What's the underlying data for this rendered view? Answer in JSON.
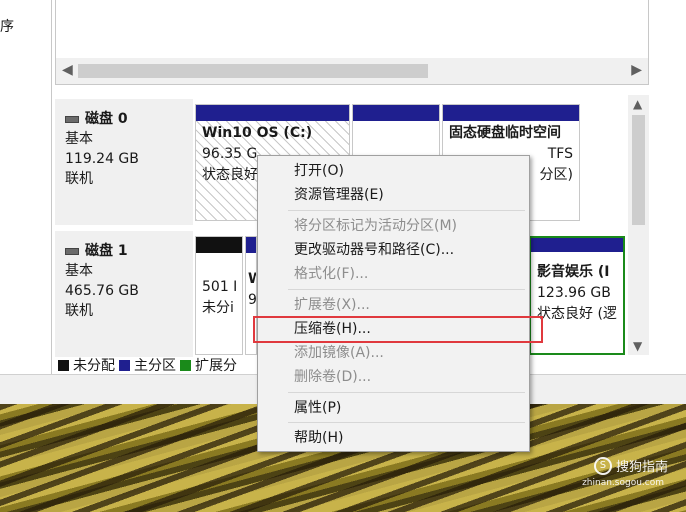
{
  "left_pane": {
    "label": "序"
  },
  "disks": [
    {
      "name": "磁盘 0",
      "type": "基本",
      "size": "119.24 GB",
      "status": "联机",
      "partitions": [
        {
          "title": "Win10 OS  (C:)",
          "line2": "96.35 G",
          "line3": "状态良好"
        },
        {
          "title": "",
          "line2": "",
          "line3": ""
        },
        {
          "title": "固态硬盘临时空间",
          "line2": "TFS",
          "line3": "分区)"
        }
      ]
    },
    {
      "name": "磁盘 1",
      "type": "基本",
      "size": "465.76 GB",
      "status": "联机",
      "partitions": [
        {
          "title": "",
          "line2": "501 I",
          "line3": "未分i"
        },
        {
          "title": "W",
          "line2": "9",
          "line3": ""
        },
        {
          "title": "影音娱乐  (I",
          "line2": "123.96 GB",
          "line3": "状态良好 (逻"
        }
      ]
    }
  ],
  "legend": [
    {
      "label": "未分配",
      "color": "#111111"
    },
    {
      "label": "主分区",
      "color": "#1f1f8f"
    },
    {
      "label": "扩展分",
      "color": "#1a8a1a"
    }
  ],
  "context_menu": {
    "items": [
      {
        "label": "打开(O)",
        "enabled": true
      },
      {
        "label": "资源管理器(E)",
        "enabled": true
      },
      {
        "label": "将分区标记为活动分区(M)",
        "enabled": false
      },
      {
        "label": "更改驱动器号和路径(C)...",
        "enabled": true
      },
      {
        "label": "格式化(F)...",
        "enabled": false
      },
      {
        "label": "扩展卷(X)...",
        "enabled": false
      },
      {
        "label": "压缩卷(H)...",
        "enabled": true
      },
      {
        "label": "添加镜像(A)...",
        "enabled": false
      },
      {
        "label": "删除卷(D)...",
        "enabled": false
      },
      {
        "label": "属性(P)",
        "enabled": true
      },
      {
        "label": "帮助(H)",
        "enabled": true
      }
    ]
  },
  "watermark": {
    "text": "搜狗指南",
    "sub": "zhinan.sogou.com"
  },
  "icons": {
    "scroll_left": "◀",
    "scroll_right": "▶",
    "scroll_up": "▲",
    "scroll_down": "▼"
  },
  "colors": {
    "highlight_box": "#e0393e",
    "primary_partition": "#1f1f8f"
  }
}
